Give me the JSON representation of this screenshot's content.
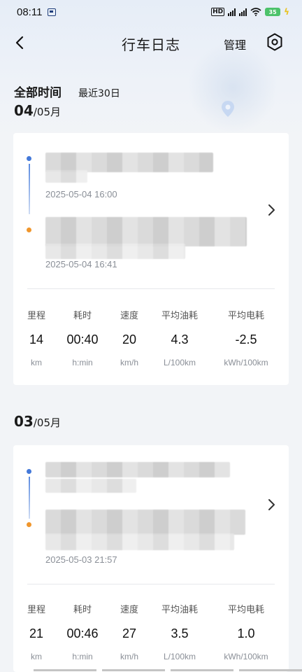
{
  "status_bar": {
    "time": "08:11",
    "battery": "35"
  },
  "header": {
    "title": "行车日志",
    "manage_label": "管理"
  },
  "filters": {
    "all_time": "全部时间",
    "last_30_days": "最近30日"
  },
  "groups": [
    {
      "day": "04",
      "month": "/05月",
      "trip": {
        "start_time": "2025-05-04 16:00",
        "end_time": "2025-05-04 16:41",
        "stats": [
          {
            "label": "里程",
            "value": "14",
            "unit": "km"
          },
          {
            "label": "耗时",
            "value": "00:40",
            "unit": "h:min"
          },
          {
            "label": "速度",
            "value": "20",
            "unit": "km/h"
          },
          {
            "label": "平均油耗",
            "value": "4.3",
            "unit": "L/100km"
          },
          {
            "label": "平均电耗",
            "value": "-2.5",
            "unit": "kWh/100km"
          }
        ]
      }
    },
    {
      "day": "03",
      "month": "/05月",
      "trip": {
        "start_time": "",
        "end_time": "2025-05-03 21:57",
        "stats": [
          {
            "label": "里程",
            "value": "21",
            "unit": "km"
          },
          {
            "label": "耗时",
            "value": "00:46",
            "unit": "h:min"
          },
          {
            "label": "速度",
            "value": "27",
            "unit": "km/h"
          },
          {
            "label": "平均油耗",
            "value": "3.5",
            "unit": "L/100km"
          },
          {
            "label": "平均电耗",
            "value": "1.0",
            "unit": "kWh/100km"
          }
        ]
      }
    }
  ],
  "colors": {
    "accent_blue": "#4479d9",
    "accent_orange": "#f0962c",
    "battery_green": "#4cc26a"
  }
}
